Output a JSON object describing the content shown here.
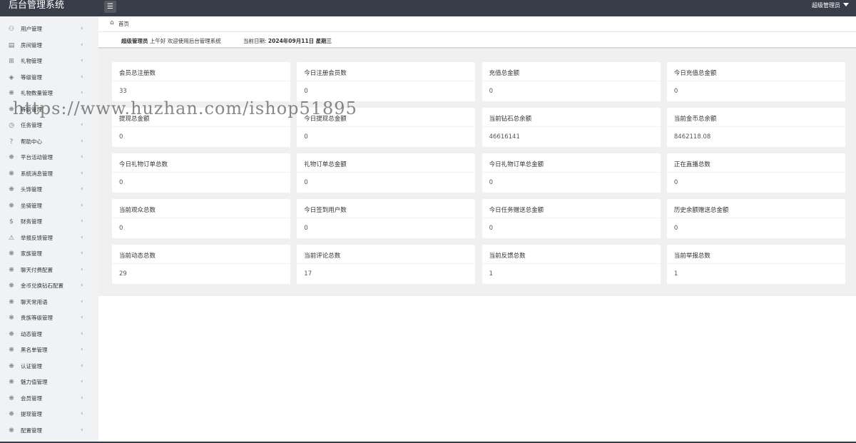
{
  "app": {
    "title": "后台管理系统",
    "user": "超级管理员"
  },
  "sidebar": {
    "items": [
      {
        "icon": "user-icon",
        "glyph": "⚇",
        "label": "用户管理"
      },
      {
        "icon": "room-icon",
        "glyph": "▤",
        "label": "房间管理"
      },
      {
        "icon": "gift-icon",
        "glyph": "⊞",
        "label": "礼物管理"
      },
      {
        "icon": "diamond-icon",
        "glyph": "◈",
        "label": "等级管理"
      },
      {
        "icon": "grid-icon",
        "glyph": "❋",
        "label": "礼物数量管理"
      },
      {
        "icon": "grid-icon",
        "glyph": "❋",
        "label": "等级管理"
      },
      {
        "icon": "clock-icon",
        "glyph": "◷",
        "label": "任务管理"
      },
      {
        "icon": "help-icon",
        "glyph": "?",
        "label": "帮助中心"
      },
      {
        "icon": "grid-icon",
        "glyph": "❋",
        "label": "平台活动管理"
      },
      {
        "icon": "grid-icon",
        "glyph": "❋",
        "label": "系统消息管理"
      },
      {
        "icon": "grid-icon",
        "glyph": "❋",
        "label": "头饰管理"
      },
      {
        "icon": "grid-icon",
        "glyph": "❋",
        "label": "坐骑管理"
      },
      {
        "icon": "dollar-icon",
        "glyph": "$",
        "label": "财务管理"
      },
      {
        "icon": "warning-icon",
        "glyph": "⚠",
        "label": "举报反馈管理"
      },
      {
        "icon": "grid-icon",
        "glyph": "❋",
        "label": "家族管理"
      },
      {
        "icon": "grid-icon",
        "glyph": "❋",
        "label": "聊天付费配置"
      },
      {
        "icon": "grid-icon",
        "glyph": "❋",
        "label": "金币兑换钻石配置"
      },
      {
        "icon": "grid-icon",
        "glyph": "❋",
        "label": "聊天常用语"
      },
      {
        "icon": "grid-icon",
        "glyph": "❋",
        "label": "贵族等级管理"
      },
      {
        "icon": "grid-icon",
        "glyph": "❋",
        "label": "动态管理"
      },
      {
        "icon": "grid-icon",
        "glyph": "❋",
        "label": "黑名单管理"
      },
      {
        "icon": "grid-icon",
        "glyph": "❋",
        "label": "认证管理"
      },
      {
        "icon": "grid-icon",
        "glyph": "❋",
        "label": "魅力值管理"
      },
      {
        "icon": "grid-icon",
        "glyph": "❋",
        "label": "会员管理"
      },
      {
        "icon": "grid-icon",
        "glyph": "❋",
        "label": "提现管理"
      },
      {
        "icon": "grid-icon",
        "glyph": "❋",
        "label": "配置管理"
      }
    ]
  },
  "breadcrumb": {
    "home": "首页"
  },
  "info": {
    "admin": "超级管理员",
    "greeting": "上午好 欢迎使用后台管理系统",
    "date_label": "当前日期:",
    "date": "2024年09月11日",
    "weekday": "星期三"
  },
  "stats": [
    {
      "title": "会员总注册数",
      "value": "33"
    },
    {
      "title": "今日注册会员数",
      "value": "0"
    },
    {
      "title": "充值总金额",
      "value": "0"
    },
    {
      "title": "今日充值总金额",
      "value": "0"
    },
    {
      "title": "提现总金额",
      "value": "0"
    },
    {
      "title": "今日提现总金额",
      "value": "0"
    },
    {
      "title": "当前钻石总余额",
      "value": "46616141"
    },
    {
      "title": "当前金币总余额",
      "value": "8462118.08"
    },
    {
      "title": "今日礼物订单总数",
      "value": "0"
    },
    {
      "title": "礼物订单总金额",
      "value": "0"
    },
    {
      "title": "今日礼物订单总金额",
      "value": "0"
    },
    {
      "title": "正在直播总数",
      "value": "0"
    },
    {
      "title": "当前观众总数",
      "value": "0"
    },
    {
      "title": "今日签到用户数",
      "value": "0"
    },
    {
      "title": "今日任务赠送总金额",
      "value": "0"
    },
    {
      "title": "历史余额赠送总金额",
      "value": "0"
    },
    {
      "title": "当前动态总数",
      "value": "29"
    },
    {
      "title": "当前评论总数",
      "value": "17"
    },
    {
      "title": "当前反馈总数",
      "value": "1"
    },
    {
      "title": "当前举报总数",
      "value": "1"
    }
  ],
  "watermark": "https://www.huzhan.com/ishop51895"
}
